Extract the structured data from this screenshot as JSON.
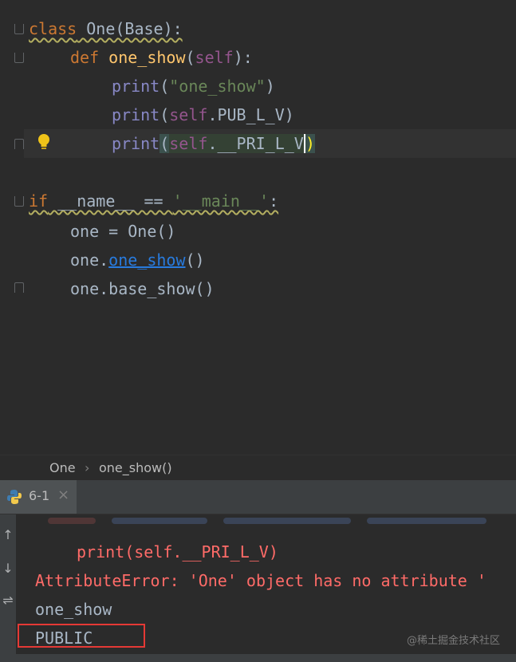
{
  "editor": {
    "code": {
      "l1": {
        "kw": "class",
        "name": " One(Base):"
      },
      "l2": {
        "kw": "def",
        "fn": "one_show",
        "open": "(",
        "self": "self",
        "close": "):"
      },
      "l3": {
        "bi": "print",
        "open": "(",
        "str": "\"one_show\"",
        "close": ")"
      },
      "l4": {
        "bi": "print",
        "open": "(",
        "self": "self",
        "rest": ".PUB_L_V)"
      },
      "l5": {
        "bi": "print",
        "open": "(",
        "self": "self",
        "rest": ".__PRI_L_V",
        "close": ")"
      },
      "l7": {
        "kw": "if",
        "mid": " __name__ == ",
        "str": "'__main__'",
        "end": ":"
      },
      "l8": {
        "text": "one = One()"
      },
      "l9": {
        "pre": "one.",
        "link": "one_show",
        "post": "()"
      },
      "l10": {
        "text": "one.base_show()"
      }
    }
  },
  "breadcrumb": {
    "item1": "One",
    "sep": "›",
    "item2": "one_show()"
  },
  "run": {
    "tab_label": "6-1",
    "tab_close": "×",
    "output": {
      "line1": "print(self.__PRI_L_V)",
      "line2": "AttributeError: 'One' object has no attribute '",
      "line3": "one_show",
      "line4": "PUBLIC"
    },
    "tools": [
      "↑",
      "↓",
      "⇌"
    ],
    "watermark": "@稀土掘金技术社区"
  },
  "colors": {
    "accent_error": "#ff6b68",
    "highlight_box": "#e53935",
    "background": "#2b2b2b"
  }
}
